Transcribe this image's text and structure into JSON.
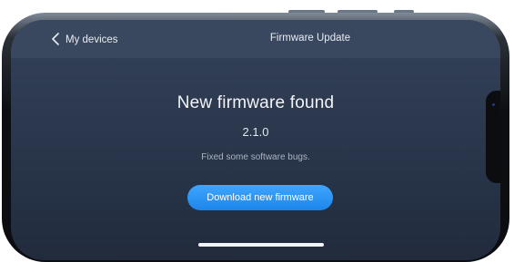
{
  "nav": {
    "back_label": "My devices",
    "title": "Firmware Update"
  },
  "firmware": {
    "headline": "New firmware found",
    "version": "2.1.0",
    "notes": "Fixed some software bugs."
  },
  "actions": {
    "download_label": "Download new firmware"
  },
  "icons": {
    "back": "chevron-left-icon"
  },
  "colors": {
    "accent": "#2a93f5",
    "screen_bg": "#2d3a50",
    "navbar_bg": "#3a485f",
    "text_primary": "#f2f4f8",
    "text_secondary": "#aab3c2"
  }
}
